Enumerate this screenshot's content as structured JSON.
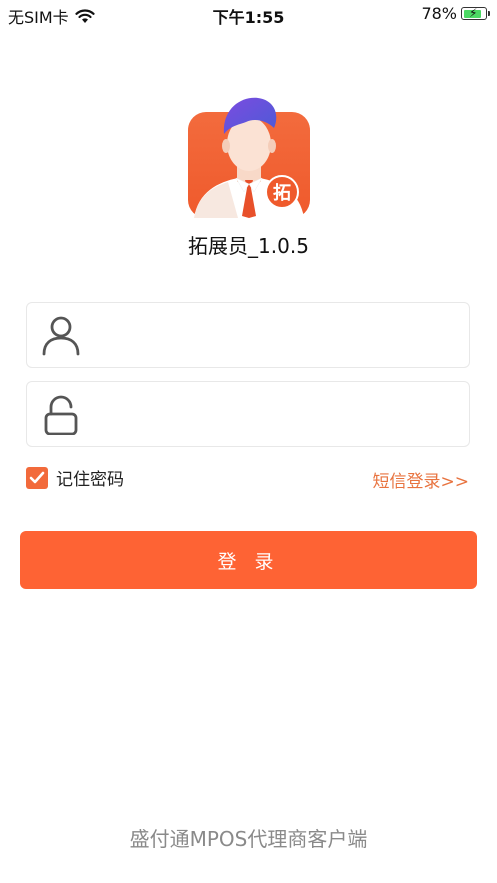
{
  "status_bar": {
    "carrier": "无SIM卡",
    "time": "下午1:55",
    "battery": "78%",
    "battery_level": 0.78
  },
  "app": {
    "name": "拓展员_1.0.5",
    "logo_badge": "拓",
    "logo_icon": "salesman-avatar-icon"
  },
  "form": {
    "username_icon": "user-icon",
    "password_icon": "lock-icon",
    "username_value": "",
    "password_value": "",
    "remember_label": "记住密码",
    "remember_checked": true,
    "sms_login_label": "短信登录>>",
    "login_label": "登 录"
  },
  "footer": {
    "text": "盛付通MPOS代理商客户端"
  },
  "colors": {
    "accent": "#fe6334",
    "link": "#e8733f",
    "checkbox": "#f26a3b"
  }
}
